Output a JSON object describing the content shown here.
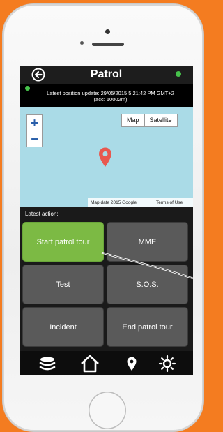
{
  "header": {
    "title": "Patrol",
    "status_color": "#46c24b"
  },
  "position": {
    "line1": "Latest position update: 29/05/2015 5:21:42 PM GMT+2",
    "line2": "(acc: 10002m)"
  },
  "map": {
    "zoom_in": "+",
    "zoom_out": "−",
    "type_map": "Map",
    "type_satellite": "Satellite",
    "attribution": "Map date 2015 Google",
    "terms": "Terms of Use",
    "pin_color": "#e8584f",
    "water_color": "#aadbe7"
  },
  "actions": {
    "label": "Latest action:",
    "buttons": [
      {
        "label": "Start patrol tour",
        "active": true
      },
      {
        "label": "MME"
      },
      {
        "label": "Test"
      },
      {
        "label": "S.O.S."
      },
      {
        "label": "Incident"
      },
      {
        "label": "End patrol tour"
      }
    ],
    "active_color": "#7cba44",
    "button_color": "#5a5a5a"
  },
  "nav": {
    "icons": [
      "layers-icon",
      "home-icon",
      "location-pin-icon",
      "brightness-icon"
    ]
  },
  "colors": {
    "background": "#f47c20",
    "phone": "#f2f2f2"
  }
}
